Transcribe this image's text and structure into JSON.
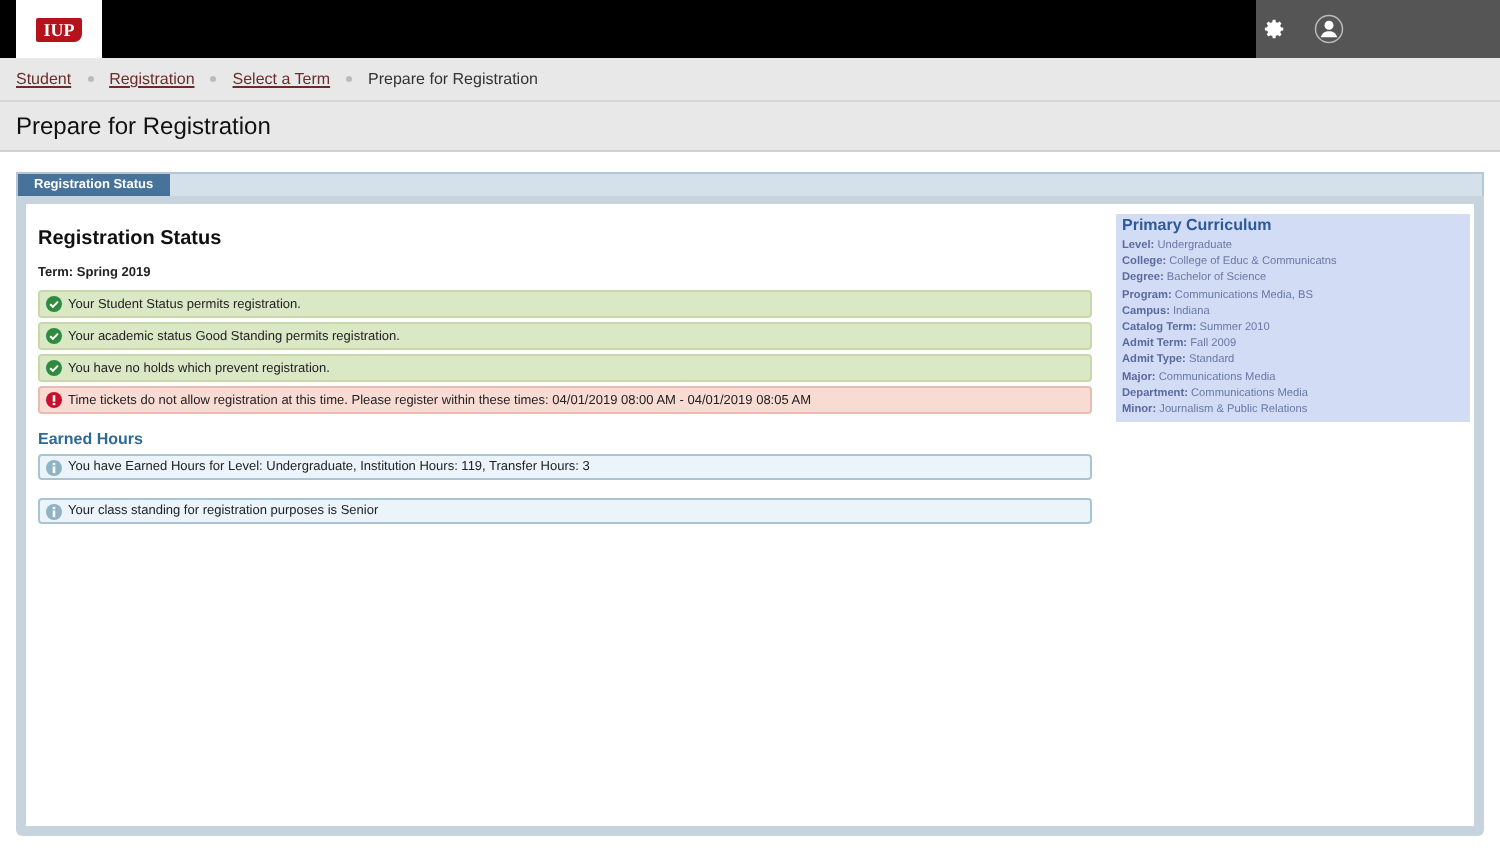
{
  "header": {
    "logo": "IUP"
  },
  "breadcrumb": [
    {
      "label": "Student",
      "kind": "link"
    },
    {
      "label": "Registration",
      "kind": "link"
    },
    {
      "label": "Select a Term",
      "kind": "link"
    },
    {
      "label": "Prepare for Registration",
      "kind": "current"
    }
  ],
  "page_title": "Prepare for Registration",
  "tabs": [
    {
      "label": "Registration Status",
      "selected": true
    }
  ],
  "status": {
    "title": "Registration Status",
    "term": "Term: Spring 2019",
    "messages": [
      {
        "kind": "success",
        "text": "Your Student Status permits registration."
      },
      {
        "kind": "success",
        "text": "Your academic status Good Standing permits registration."
      },
      {
        "kind": "success",
        "text": "You have no holds which prevent registration."
      },
      {
        "kind": "error",
        "text": "Time tickets do not allow registration at this time. Please register within these times: 04/01/2019 08:00 AM - 04/01/2019 08:05 AM"
      }
    ]
  },
  "earned_hours": {
    "title": "Earned Hours",
    "messages": [
      {
        "kind": "info",
        "text": "You have Earned Hours for Level: Undergraduate, Institution Hours: 119, Transfer Hours: 3"
      },
      {
        "kind": "info",
        "text": "Your class standing for registration purposes is Senior"
      }
    ]
  },
  "curriculum": {
    "title": "Primary Curriculum",
    "fields": [
      {
        "label": "Level:",
        "value": "Undergraduate"
      },
      {
        "label": "College:",
        "value": "College of Educ & Communicatns"
      },
      {
        "label": "Degree:",
        "value": "Bachelor of Science"
      },
      {
        "label": "Program:",
        "value": "Communications Media, BS"
      },
      {
        "label": "Campus:",
        "value": "Indiana"
      },
      {
        "label": "Catalog Term:",
        "value": "Summer 2010"
      },
      {
        "label": "Admit Term:",
        "value": "Fall 2009"
      },
      {
        "label": "Admit Type:",
        "value": "Standard"
      },
      {
        "label": "Major:",
        "value": "Communications Media"
      },
      {
        "label": "Department:",
        "value": "Communications Media"
      },
      {
        "label": "Minor:",
        "value": "Journalism & Public Relations"
      }
    ]
  }
}
